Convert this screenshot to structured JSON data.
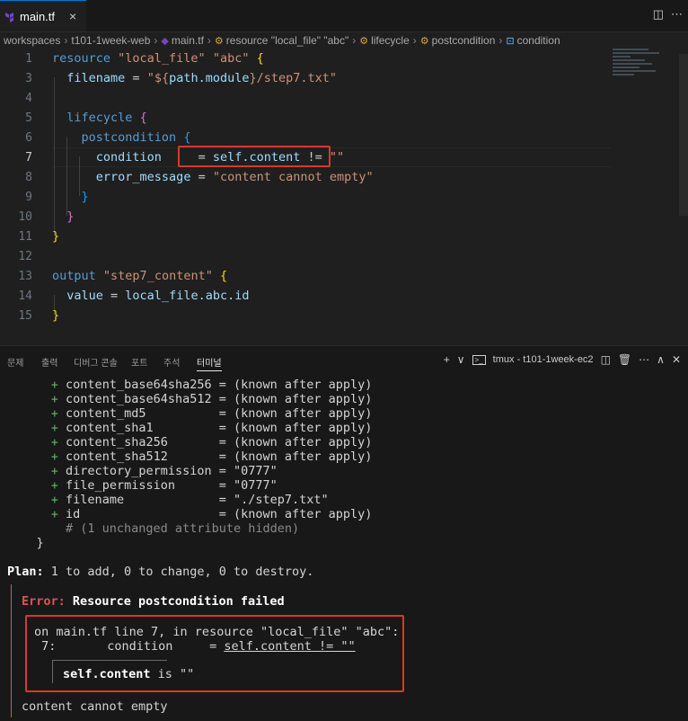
{
  "tab": {
    "filename": "main.tf",
    "close": "×"
  },
  "tab_tools": {
    "split": "◫",
    "more": "⋯"
  },
  "breadcrumb": [
    "workspaces",
    "t101-1week-web",
    "main.tf",
    "resource \"local_file\" \"abc\"",
    "lifecycle",
    "postcondition",
    "condition"
  ],
  "editor_lines": [
    {
      "num": "1",
      "text": "resource \"local_file\" \"abc\" {"
    },
    {
      "num": "3",
      "text": "  filename = \"${path.module}/step7.txt\""
    },
    {
      "num": "4",
      "text": ""
    },
    {
      "num": "5",
      "text": "  lifecycle {"
    },
    {
      "num": "6",
      "text": "    postcondition {"
    },
    {
      "num": "7",
      "text": "      condition     = self.content != \"\""
    },
    {
      "num": "8",
      "text": "      error_message = \"content cannot empty\""
    },
    {
      "num": "9",
      "text": "    }"
    },
    {
      "num": "10",
      "text": "  }"
    },
    {
      "num": "11",
      "text": "}"
    },
    {
      "num": "12",
      "text": ""
    },
    {
      "num": "13",
      "text": "output \"step7_content\" {"
    },
    {
      "num": "14",
      "text": "  value = local_file.abc.id"
    },
    {
      "num": "15",
      "text": "}"
    }
  ],
  "panel_tabs": [
    "문제",
    "출력",
    "디버그 콘솔",
    "포트",
    "주석",
    "터미널"
  ],
  "panel_tools": {
    "add": "+",
    "dropdown": "∨",
    "terminal_name": "tmux - t101-1week-ec2",
    "split": "◫",
    "trash": "🗑",
    "more": "⋯",
    "maximize": "∧",
    "close": "✕"
  },
  "terminal_lines": [
    "      + content_base64sha256 = (known after apply)",
    "      + content_base64sha512 = (known after apply)",
    "      + content_md5          = (known after apply)",
    "      + content_sha1         = (known after apply)",
    "      + content_sha256       = (known after apply)",
    "      + content_sha512       = (known after apply)",
    "      + directory_permission = \"0777\"",
    "      + file_permission      = \"0777\"",
    "      + filename             = \"./step7.txt\"",
    "      + id                   = (known after apply)",
    "        # (1 unchanged attribute hidden)",
    "    }"
  ],
  "plan": {
    "label": "Plan:",
    "text": " 1 to add, 0 to change, 0 to destroy."
  },
  "error": {
    "label": "Error:",
    "title": " Resource postcondition failed",
    "location": "on main.tf line 7, in resource \"local_file\" \"abc\":",
    "line_prefix": " 7:       condition     = ",
    "line_expr": "self.content != \"\"",
    "expr_value": "self.content",
    "expr_result": " is \"\"",
    "message": "content cannot empty"
  }
}
